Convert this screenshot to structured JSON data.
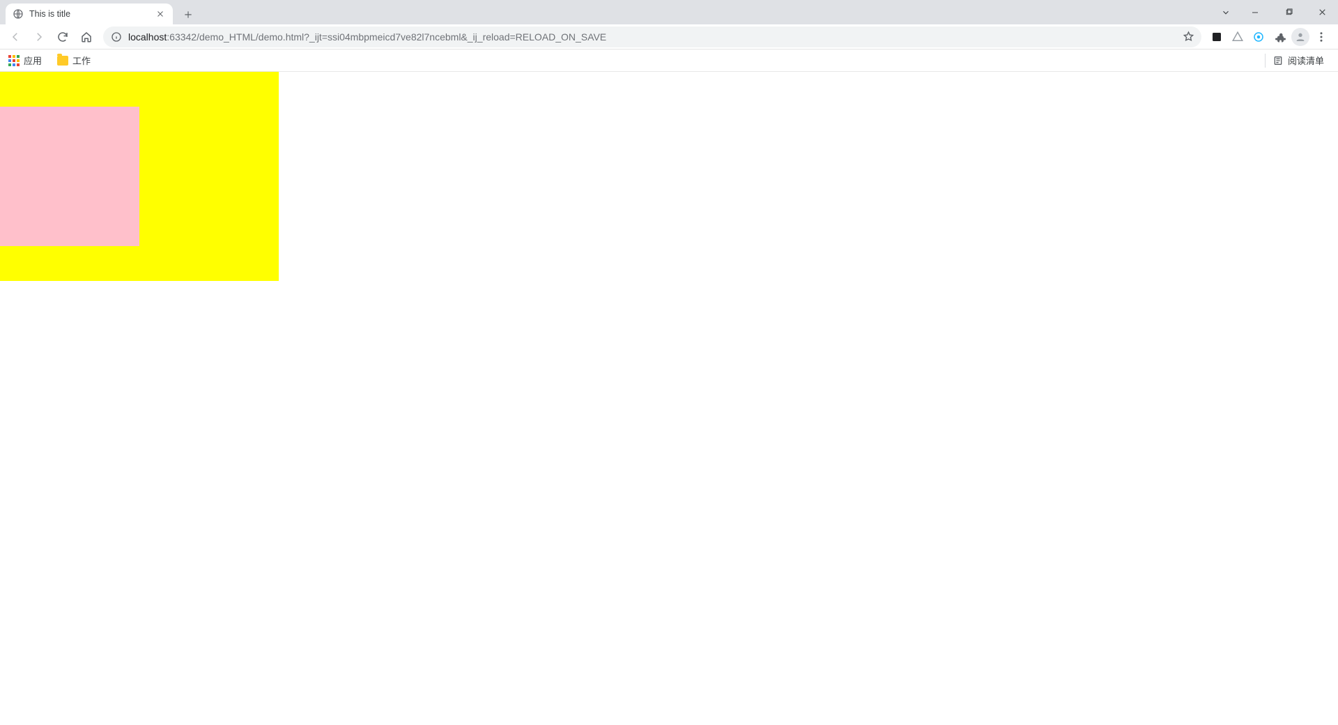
{
  "tab": {
    "title": "This is title"
  },
  "url": {
    "host": "localhost",
    "rest": ":63342/demo_HTML/demo.html?_ijt=ssi04mbpmeicd7ve82l7ncebml&_ij_reload=RELOAD_ON_SAVE"
  },
  "bookmarks": {
    "apps_label": "应用",
    "folder1_label": "工作",
    "reading_list_label": "阅读清单"
  },
  "page": {
    "outer_box_color": "#ffff00",
    "inner_box_color": "#ffc0cb"
  }
}
